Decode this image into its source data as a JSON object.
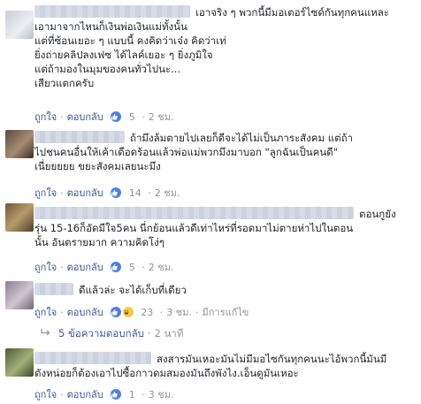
{
  "comments": [
    {
      "lines": [
        "เอาจริง ๆ พวกนี้มีมอเตอร์ไซด์กันทุกคนแหละ",
        "เอามาจากไหนก็เงินพ่อเงินแม่ทั้งนั้น",
        "แต่ที่ซ้อนเยอะ ๆ แบบนี้ คงคิดว่าเจ๋ง คิดว่าเท่",
        "ยิ่งถ่ายคลิปลงเฟซ ได้ไลค์เยอะ ๆ ยิ่งภูมิใจ",
        "แต่ถ้ามองในมุมของคนทั่วไปนะ...",
        "เสียวแตกครับ"
      ],
      "like": "ถูกใจ",
      "reply": "ตอบกลับ",
      "reactions": "5",
      "time": "2 ชม."
    },
    {
      "lines": [
        "ถ้ามึงล้มตายไปเลยก็ดีจะได้ไม่เป็นภาระสังคม แต่ถ้า",
        "ไปชนคนอื่นให้เค้าเดือดร้อนแล้วพ่อแม่พวกมึงมาบอก \"ลูกฉันเป็นคนดี\"",
        "เนี่ยยยยย ขยะสังคมเลยนะมึง"
      ],
      "like": "ถูกใจ",
      "reply": "ตอบกลับ",
      "reactions": "14",
      "time": "2 ชม."
    },
    {
      "lines": [
        "ตอนกูยัง",
        "รุ่น 15-16ก็อัดมีใจ5คน นี่กย้อนแล้วดีเท่าไหร่ที่รอดมาไม่ตายห่าไปในตอน",
        "นั้น อันตรายมาก ความคิดโง่ๆ"
      ],
      "like": "ถูกใจ",
      "reply": "ตอบกลับ",
      "reactions": "5",
      "time": "2 ชม."
    },
    {
      "lines": [
        "ดีแล้วล่ะ จะได้เก็บที่เดียว"
      ],
      "like": "ถูกใจ",
      "reply": "ตอบกลับ",
      "reactions": "23",
      "time": "3 ชม.",
      "edited": "มีการแก้ไข"
    },
    {
      "lines": [
        "สงสารมันเหอะมันไม่มีมอไซกันทุกคนนะไอ้พวกนี้มันมี",
        "ตังหน่อยก็ต้องเอาไปซื้อกาวดมสมองมันถึงพังไง.เอ็นดูมันเหอะ"
      ],
      "like": "ถูกใจ",
      "reply": "ตอบกลับ",
      "reactions": "1",
      "time": "3 ชม."
    }
  ],
  "replies_link": {
    "label": "5 ข้อความตอบกลับ",
    "time": "2 นาที"
  },
  "colors": {
    "link": "#385898",
    "meta": "#90949c",
    "like": "#4f7ef0",
    "haha": "#f7c94b"
  }
}
